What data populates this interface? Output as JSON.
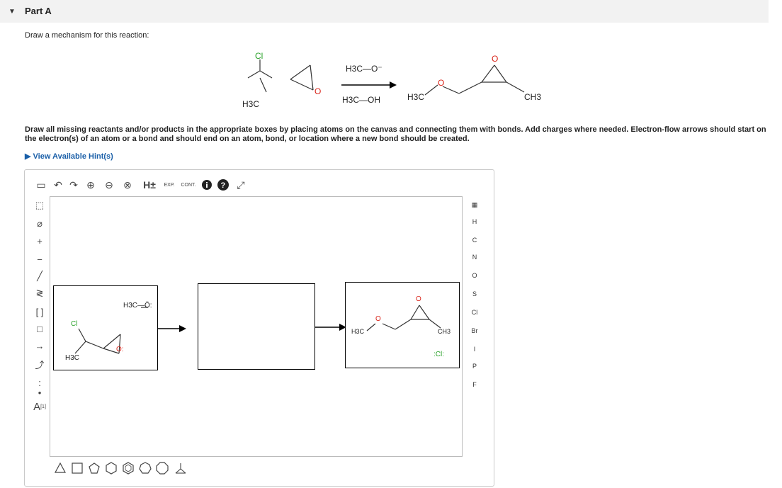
{
  "part": {
    "title": "Part A"
  },
  "instruction": "Draw a mechanism for this reaction:",
  "reaction": {
    "reactant_substituent": "Cl",
    "reactant_methyl": "H3C",
    "reactant_oxygen": "O",
    "reagent_top": "H3C—O⁻",
    "reagent_bottom": "H3C—OH",
    "product_left_methyl": "H3C",
    "product_ether_oxygen": "O",
    "product_epoxide_oxygen": "O",
    "product_right_methyl": "CH3"
  },
  "task_instruction": "Draw all missing reactants and/or products in the appropriate boxes by placing atoms on the canvas and connecting them with bonds. Add charges where needed. Electron-flow arrows should start on the electron(s) of an atom or a bond and should end on an atom, bond, or location where a new bond should be created.",
  "hints_label": "View Available Hint(s)",
  "toolbar": {
    "h_label": "H±",
    "exp_label": "EXP.",
    "cont_label": "CONT."
  },
  "atoms": [
    "H",
    "C",
    "N",
    "O",
    "S",
    "Cl",
    "Br",
    "I",
    "P",
    "F"
  ],
  "canvas": {
    "box1": {
      "nucleophile": "H3C—Ö:",
      "chlorine": "Cl",
      "methyl": "H3C",
      "oxygen": "O:"
    },
    "box3": {
      "left_methyl": "H3C",
      "ether_oxygen": "O",
      "epoxide_oxygen": "O",
      "right_methyl": "CH3",
      "chloride": ":Cl:"
    }
  },
  "left_tools": {
    "label_tool": "A",
    "label_index": "[1]"
  },
  "colors": {
    "accent_link": "#1a5fa8",
    "chlorine_green": "#2aa12a",
    "oxygen_red": "#d9261c"
  }
}
